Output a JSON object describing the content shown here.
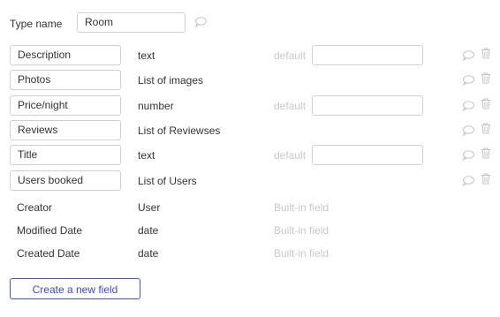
{
  "type_name": {
    "label": "Type name",
    "value": "Room"
  },
  "fields": [
    {
      "name": "Description",
      "type": "text",
      "default_label": "default",
      "has_default": true
    },
    {
      "name": "Photos",
      "type": "List of images",
      "default_label": "",
      "has_default": false
    },
    {
      "name": "Price/night",
      "type": "number",
      "default_label": "default",
      "has_default": true
    },
    {
      "name": "Reviews",
      "type": "List of Reviewses",
      "default_label": "",
      "has_default": false
    },
    {
      "name": "Title",
      "type": "text",
      "default_label": "default",
      "has_default": true
    },
    {
      "name": "Users booked",
      "type": "List of Users",
      "default_label": "",
      "has_default": false
    }
  ],
  "builtin_fields": [
    {
      "name": "Creator",
      "type": "User",
      "label": "Built-in field"
    },
    {
      "name": "Modified Date",
      "type": "date",
      "label": "Built-in field"
    },
    {
      "name": "Created Date",
      "type": "date",
      "label": "Built-in field"
    }
  ],
  "create_button": {
    "label": "Create a new field"
  },
  "icons": {
    "comment": "comment-icon",
    "trash": "trash-icon"
  },
  "colors": {
    "accent": "#3f4ab8",
    "muted_text": "#c9c9c9",
    "border": "#d0d0d0",
    "icon": "#c4c4c4"
  }
}
